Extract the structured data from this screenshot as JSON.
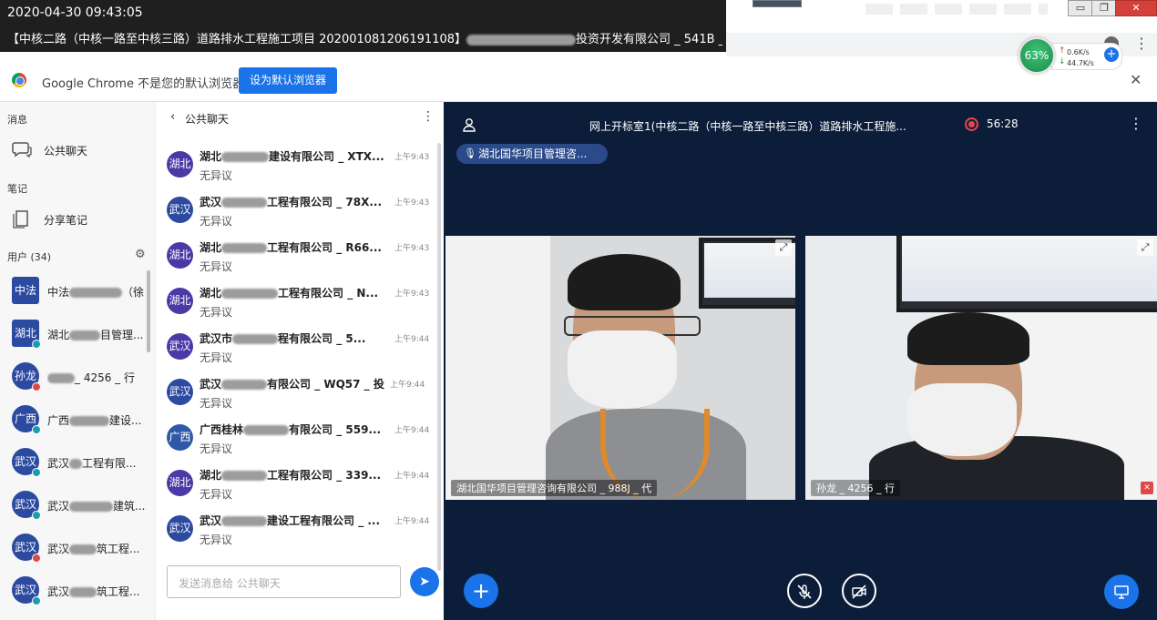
{
  "overlay": {
    "timestamp": "2020-04-30 09:43:05",
    "project_title_prefix": "【中核二路（中核一路至中核三路）道路排水工程施工项目 202001081206191108】",
    "project_title_suffix": "投资开发有限公司 _ 541B _ 招"
  },
  "window_controls": {
    "minimize": "▭",
    "maximize": "❐",
    "close": "✕"
  },
  "network": {
    "percent": "63%",
    "up": "0.6K/s",
    "down": "44.7K/s",
    "up_arrow": "↑",
    "down_arrow": "↓",
    "plus": "+"
  },
  "infobar": {
    "message": "Google Chrome 不是您的默认浏览器",
    "button": "设为默认浏览器",
    "close": "✕"
  },
  "left": {
    "messages_label": "消息",
    "public_chat": "公共聊天",
    "notes_label": "笔记",
    "shared_notes": "分享笔记",
    "users_label": "用户 (34)",
    "users": [
      {
        "avatar": "中法",
        "name": "中法",
        "suffix": "（徐",
        "badge": ""
      },
      {
        "avatar": "湖北",
        "name": "湖北",
        "suffix": "目管理...",
        "badge": "teal"
      },
      {
        "avatar": "孙龙",
        "name": "",
        "suffix": "_ 4256 _ 行",
        "badge": "red"
      },
      {
        "avatar": "广西",
        "name": "广西",
        "suffix": "建设...",
        "badge": "teal"
      },
      {
        "avatar": "武汉",
        "name": "武汉",
        "suffix": "工程有限...",
        "badge": "teal"
      },
      {
        "avatar": "武汉",
        "name": "武汉",
        "suffix": "建筑...",
        "badge": "teal"
      },
      {
        "avatar": "武汉",
        "name": "武汉",
        "suffix": "筑工程...",
        "badge": "red"
      },
      {
        "avatar": "武汉",
        "name": "武汉",
        "suffix": "筑工程...",
        "badge": "teal"
      }
    ]
  },
  "chat": {
    "back": "‹",
    "title": "公共聊天",
    "more": "⋮",
    "messages": [
      {
        "avatar": "湖北",
        "sender_a": "湖北",
        "sender_b": "建设有限公司 _ XTX...",
        "time": "上午9:43",
        "text": "无异议"
      },
      {
        "avatar": "武汉",
        "sender_a": "武汉",
        "sender_b": "工程有限公司 _ 78X...",
        "time": "上午9:43",
        "text": "无异议"
      },
      {
        "avatar": "湖北",
        "sender_a": "湖北",
        "sender_b": "工程有限公司 _ R66...",
        "time": "上午9:43",
        "text": "无异议"
      },
      {
        "avatar": "湖北",
        "sender_a": "湖北",
        "sender_b": "工程有限公司 _ N...",
        "time": "上午9:43",
        "text": "无异议"
      },
      {
        "avatar": "武汉",
        "sender_a": "武汉市",
        "sender_b": "程有限公司 _ 5...",
        "time": "上午9:44",
        "text": "无异议"
      },
      {
        "avatar": "武汉",
        "sender_a": "武汉",
        "sender_b": "有限公司 _ WQ57 _ 投",
        "time": "上午9:44",
        "text": "无异议"
      },
      {
        "avatar": "广西",
        "sender_a": "广西桂林",
        "sender_b": "有限公司 _ 559...",
        "time": "上午9:44",
        "text": "无异议"
      },
      {
        "avatar": "湖北",
        "sender_a": "湖北",
        "sender_b": "工程有限公司 _ 339...",
        "time": "上午9:44",
        "text": "无异议"
      },
      {
        "avatar": "武汉",
        "sender_a": "武汉",
        "sender_b": "建设工程有限公司 _ ...",
        "time": "上午9:44",
        "text": "无异议"
      }
    ],
    "input_placeholder": "发送消息给 公共聊天",
    "send_icon": "➤"
  },
  "video": {
    "room_title": "网上开标室1(中核二路（中核一路至中核三路）道路排水工程施...",
    "record_time": "56:28",
    "more": "⋮",
    "speaking": "湖北国华项目管理咨...",
    "tiles": [
      {
        "label": "湖北国华项目管理咨询有限公司 _ 988J _ 代"
      },
      {
        "label": "孙龙 _ 4256 _ 行"
      }
    ],
    "controls": {
      "plus": "+",
      "mic": "🎤",
      "cam": "📷",
      "screen": "🖵"
    }
  },
  "colors": {
    "accent": "#1a73e8",
    "video_bg": "#0b1d39",
    "avatar_blue": "#2c4aa0",
    "record_red": "#e04848"
  }
}
